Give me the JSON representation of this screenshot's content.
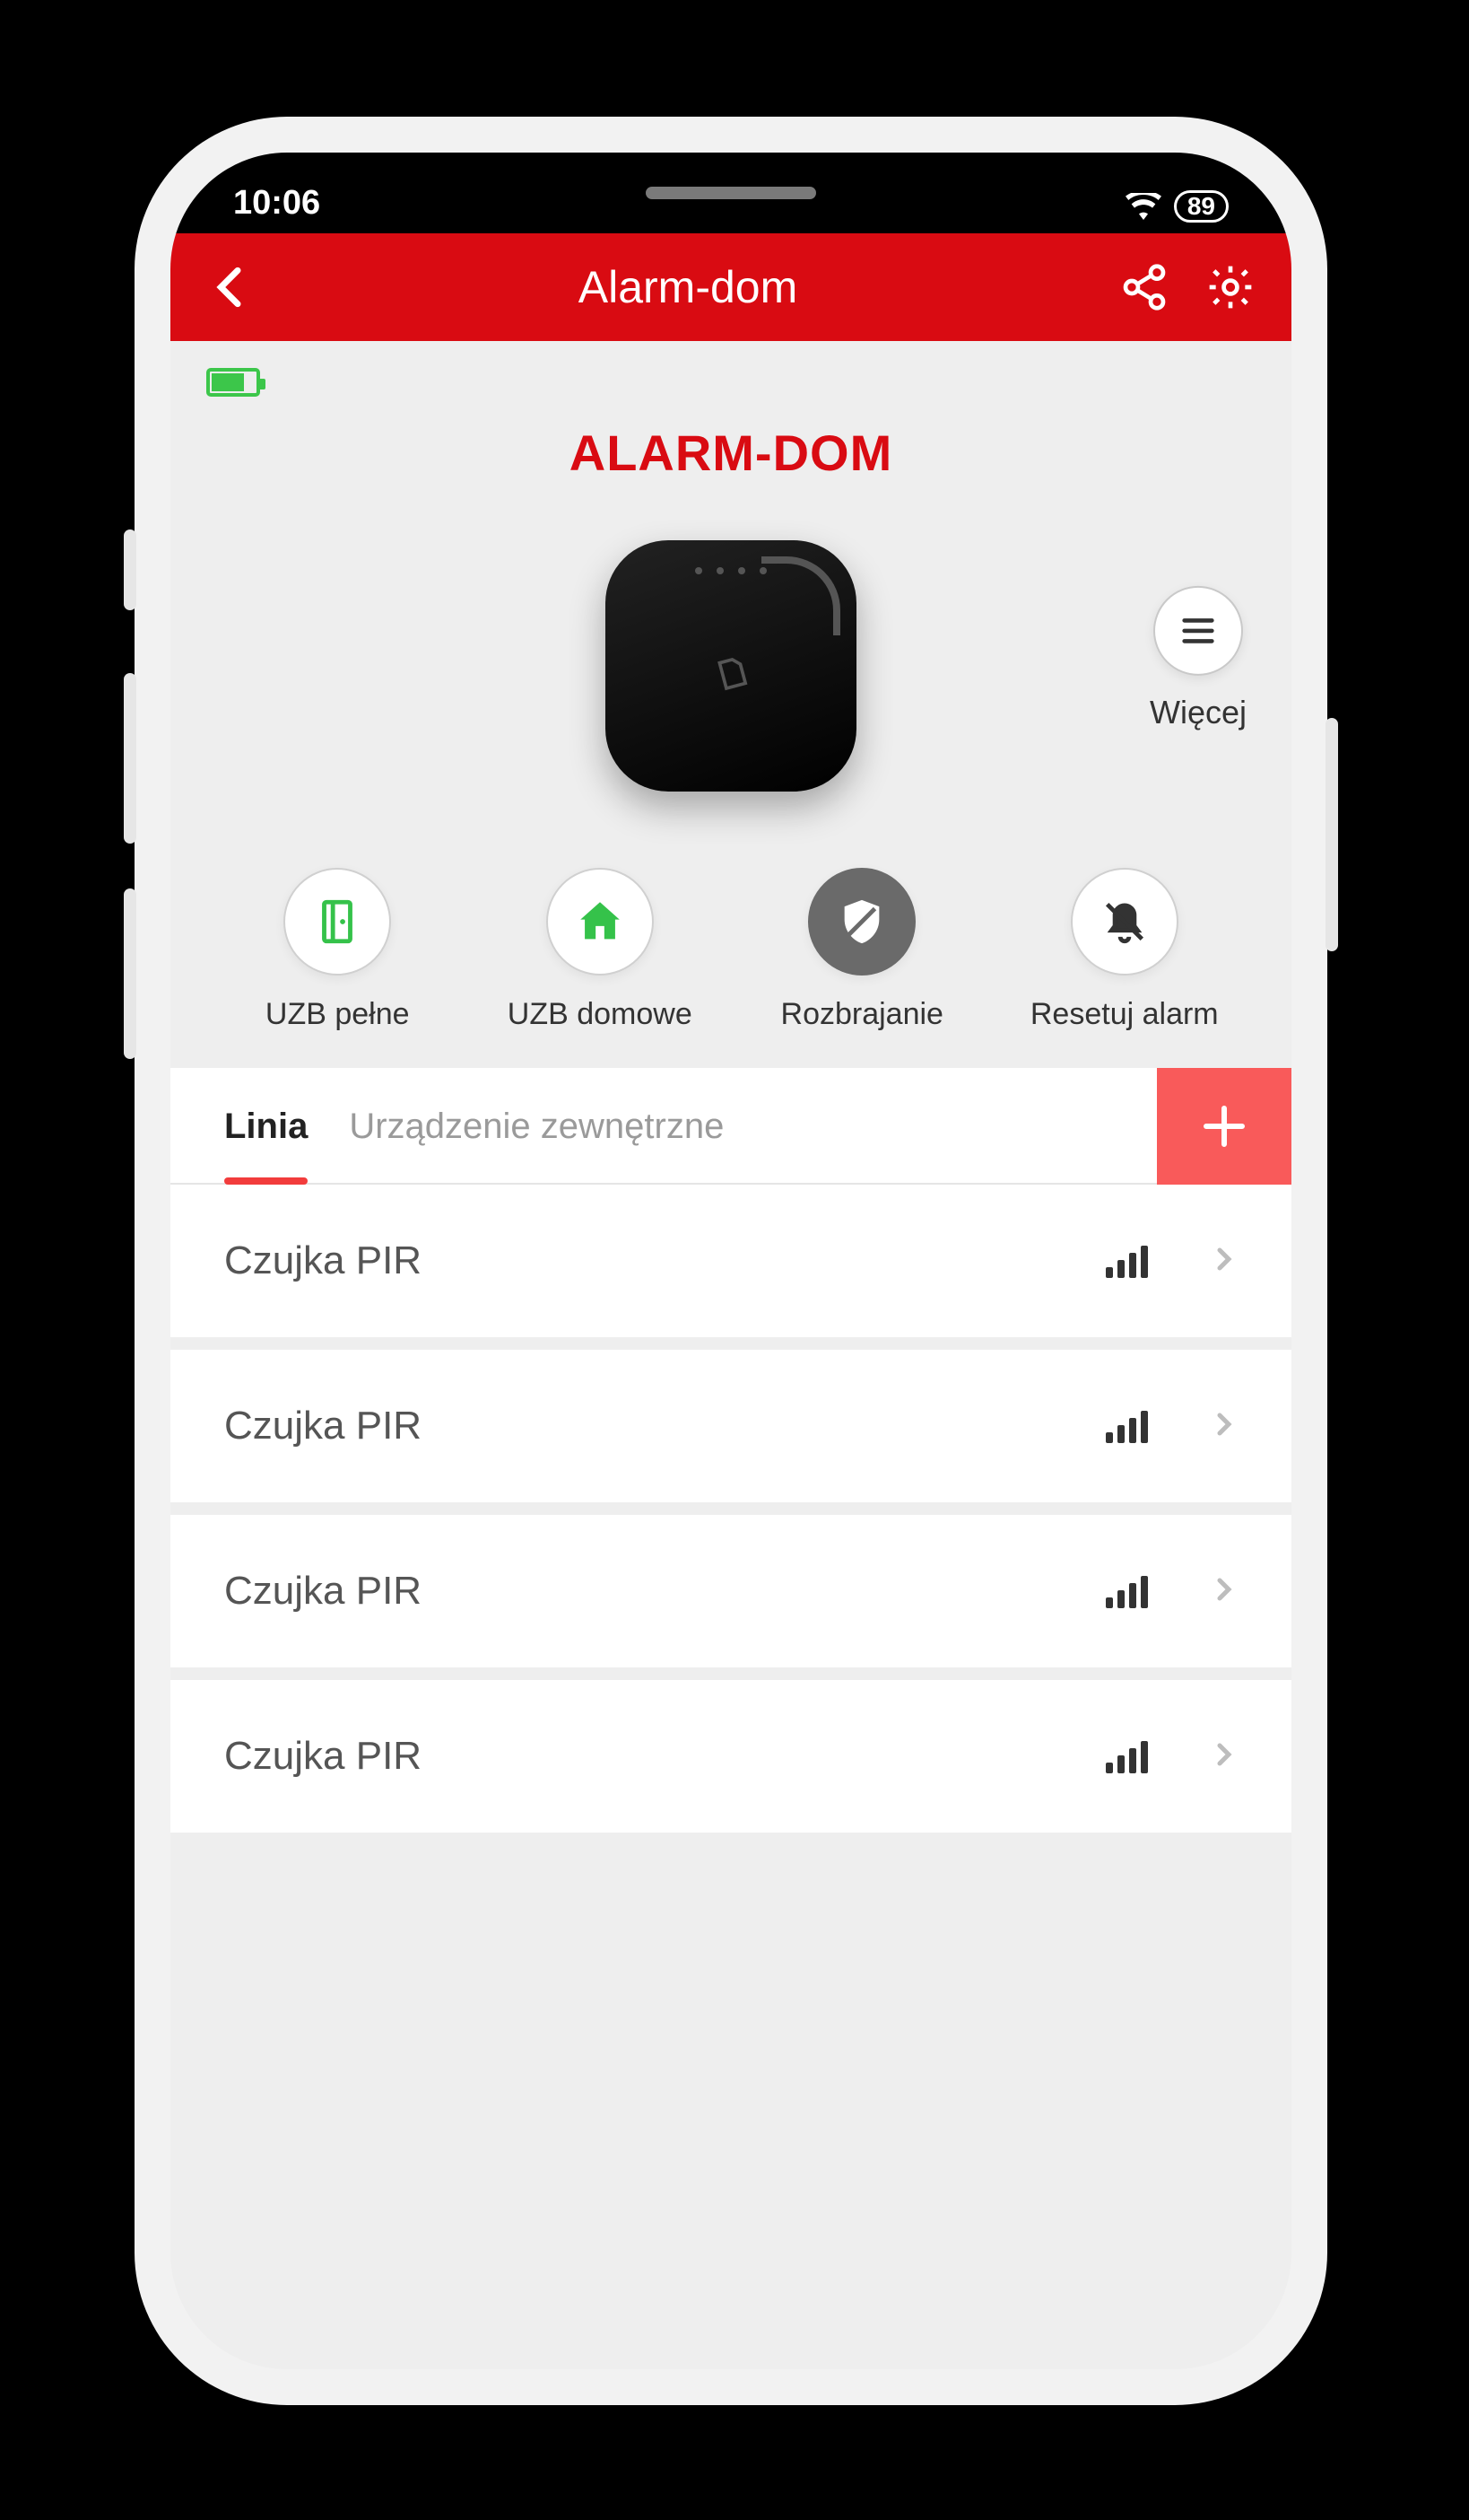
{
  "status": {
    "time": "10:06",
    "battery": "89"
  },
  "header": {
    "back_icon": "chevron-left",
    "title": "Alarm-dom",
    "share_icon": "share",
    "settings_icon": "gear"
  },
  "device": {
    "title": "ALARM-DOM",
    "more_label": "Więcej"
  },
  "actions": [
    {
      "id": "arm-full",
      "label": "UZB pełne",
      "icon": "door",
      "style": "light"
    },
    {
      "id": "arm-home",
      "label": "UZB domowe",
      "icon": "home",
      "style": "light"
    },
    {
      "id": "disarm",
      "label": "Rozbrajanie",
      "icon": "shield",
      "style": "dark"
    },
    {
      "id": "reset",
      "label": "Resetuj alarm",
      "icon": "bell-off",
      "style": "light"
    }
  ],
  "tabs": {
    "items": [
      {
        "label": "Linia",
        "active": true
      },
      {
        "label": "Urządzenie zewnętrzne",
        "active": false
      }
    ],
    "add_icon": "plus"
  },
  "list": [
    {
      "name": "Czujka PIR"
    },
    {
      "name": "Czujka PIR"
    },
    {
      "name": "Czujka PIR"
    },
    {
      "name": "Czujka PIR"
    }
  ]
}
